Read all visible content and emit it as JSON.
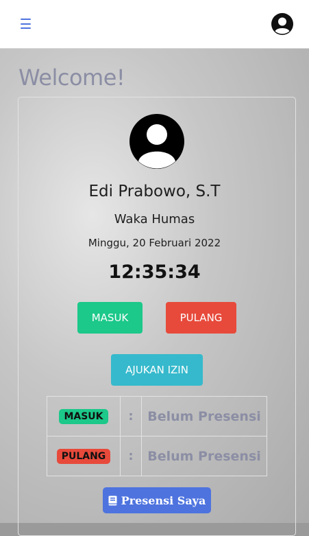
{
  "header": {
    "menu_icon": "hamburger-menu-icon",
    "avatar_icon": "user-avatar-icon"
  },
  "welcome": "Welcome!",
  "profile": {
    "photo_icon": "user-avatar-icon",
    "name": "Edi Prabowo, S.T",
    "role": "Waka Humas",
    "date": "Minggu, 20 Februari 2022",
    "time": "12:35:34"
  },
  "actions": {
    "masuk_label": "MASUK",
    "pulang_label": "PULANG",
    "izin_label": "AJUKAN IZIN"
  },
  "status": [
    {
      "label": "MASUK",
      "separator": ":",
      "value": "Belum Presensi"
    },
    {
      "label": "PULANG",
      "separator": ":",
      "value": "Belum Presensi"
    }
  ],
  "presensi_button": {
    "label": "Presensi Saya",
    "icon": "book-icon"
  },
  "colors": {
    "primary": "#4e73df",
    "success": "#1cc88a",
    "danger": "#e74a3b",
    "info": "#36b9cc",
    "muted": "#8b8ea4"
  }
}
